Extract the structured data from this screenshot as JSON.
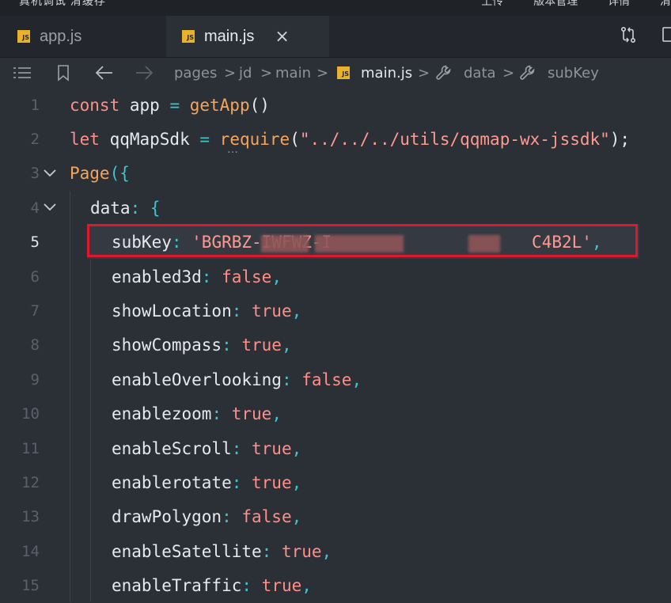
{
  "topbar": {
    "left_text": "真机调试 清缓存",
    "right_items": [
      "上传",
      "版本管理",
      "详情",
      "清"
    ]
  },
  "tabs": [
    {
      "label": "app.js",
      "icon_text": "JS",
      "active": false
    },
    {
      "label": "main.js",
      "icon_text": "JS",
      "active": true,
      "close_glyph": "×"
    }
  ],
  "breadcrumb": {
    "items": [
      "pages",
      "jd",
      "main",
      "main.js",
      "data",
      "subKey"
    ],
    "separator": ">"
  },
  "editor": {
    "current_line": 5,
    "lines": [
      {
        "num": "1",
        "tokens": [
          {
            "t": "const ",
            "c": "kw"
          },
          {
            "t": "app ",
            "c": "plain"
          },
          {
            "t": "= ",
            "c": "punc"
          },
          {
            "t": "getApp",
            "c": "fn"
          },
          {
            "t": "()",
            "c": "plain"
          }
        ]
      },
      {
        "num": "2",
        "tokens": [
          {
            "t": "let ",
            "c": "kw"
          },
          {
            "t": "qqMapSdk ",
            "c": "plain"
          },
          {
            "t": "= ",
            "c": "punc"
          },
          {
            "t": "require",
            "c": "fn"
          },
          {
            "t": "(",
            "c": "plain"
          },
          {
            "t": "\"../../../utils/qqmap-wx-jssdk\"",
            "c": "str"
          },
          {
            "t": ");",
            "c": "plain"
          }
        ]
      },
      {
        "num": "3",
        "tokens": [
          {
            "t": "Page",
            "c": "fn"
          },
          {
            "t": "({",
            "c": "punc"
          }
        ]
      },
      {
        "num": "4",
        "tokens": [
          {
            "t": "data",
            "c": "prop"
          },
          {
            "t": ": ",
            "c": "punc"
          },
          {
            "t": "{",
            "c": "punc"
          }
        ]
      },
      {
        "num": "5",
        "tokens": [
          {
            "t": "subKey",
            "c": "prop"
          },
          {
            "t": ": ",
            "c": "punc"
          },
          {
            "t": "'BGRBZ-IWFWZ-I",
            "c": "str"
          },
          {
            "t": "                    ",
            "c": "plain"
          },
          {
            "t": "C4B2L'",
            "c": "str"
          },
          {
            "t": ",",
            "c": "punc"
          }
        ]
      },
      {
        "num": "6",
        "tokens": [
          {
            "t": "enabled3d",
            "c": "prop"
          },
          {
            "t": ": ",
            "c": "punc"
          },
          {
            "t": "false",
            "c": "val"
          },
          {
            "t": ",",
            "c": "punc"
          }
        ]
      },
      {
        "num": "7",
        "tokens": [
          {
            "t": "showLocation",
            "c": "prop"
          },
          {
            "t": ": ",
            "c": "punc"
          },
          {
            "t": "true",
            "c": "val"
          },
          {
            "t": ",",
            "c": "punc"
          }
        ]
      },
      {
        "num": "8",
        "tokens": [
          {
            "t": "showCompass",
            "c": "prop"
          },
          {
            "t": ": ",
            "c": "punc"
          },
          {
            "t": "true",
            "c": "val"
          },
          {
            "t": ",",
            "c": "punc"
          }
        ]
      },
      {
        "num": "9",
        "tokens": [
          {
            "t": "enableOverlooking",
            "c": "prop"
          },
          {
            "t": ": ",
            "c": "punc"
          },
          {
            "t": "false",
            "c": "val"
          },
          {
            "t": ",",
            "c": "punc"
          }
        ]
      },
      {
        "num": "10",
        "tokens": [
          {
            "t": "enablezoom",
            "c": "prop"
          },
          {
            "t": ": ",
            "c": "punc"
          },
          {
            "t": "true",
            "c": "val"
          },
          {
            "t": ",",
            "c": "punc"
          }
        ]
      },
      {
        "num": "11",
        "tokens": [
          {
            "t": "enableScroll",
            "c": "prop"
          },
          {
            "t": ": ",
            "c": "punc"
          },
          {
            "t": "true",
            "c": "val"
          },
          {
            "t": ",",
            "c": "punc"
          }
        ]
      },
      {
        "num": "12",
        "tokens": [
          {
            "t": "enablerotate",
            "c": "prop"
          },
          {
            "t": ": ",
            "c": "punc"
          },
          {
            "t": "true",
            "c": "val"
          },
          {
            "t": ",",
            "c": "punc"
          }
        ]
      },
      {
        "num": "13",
        "tokens": [
          {
            "t": "drawPolygon",
            "c": "prop"
          },
          {
            "t": ": ",
            "c": "punc"
          },
          {
            "t": "false",
            "c": "val"
          },
          {
            "t": ",",
            "c": "punc"
          }
        ]
      },
      {
        "num": "14",
        "tokens": [
          {
            "t": "enableSatellite",
            "c": "prop"
          },
          {
            "t": ": ",
            "c": "punc"
          },
          {
            "t": "true",
            "c": "val"
          },
          {
            "t": ",",
            "c": "punc"
          }
        ]
      },
      {
        "num": "15",
        "tokens": [
          {
            "t": "enableTraffic",
            "c": "prop"
          },
          {
            "t": ": ",
            "c": "punc"
          },
          {
            "t": "true",
            "c": "val"
          },
          {
            "t": ",",
            "c": "punc"
          }
        ]
      }
    ]
  },
  "icons": {
    "outline": "list-icon",
    "bookmark": "bookmark-icon",
    "back": "arrow-left-icon",
    "forward": "arrow-right-icon",
    "wrench": "wrench-icon",
    "compare": "git-compare-icon",
    "split": "split-editor-icon"
  }
}
